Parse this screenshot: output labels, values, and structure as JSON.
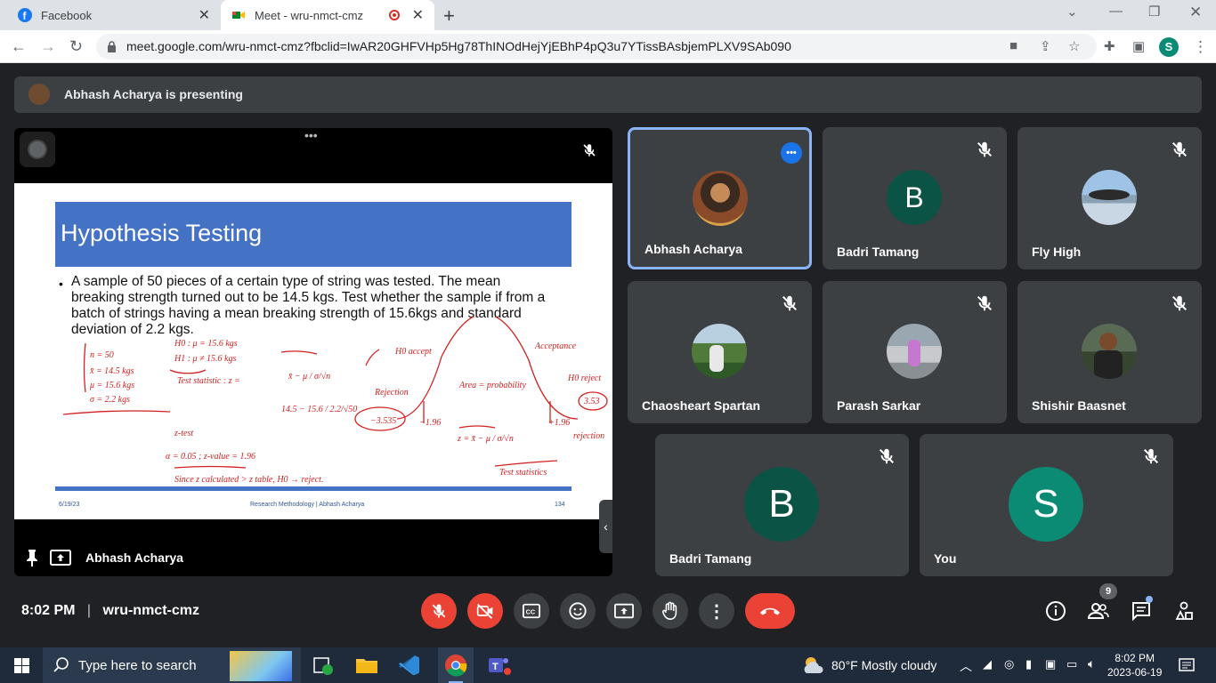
{
  "browser": {
    "tabs": [
      {
        "label": "Facebook"
      },
      {
        "label": "Meet - wru-nmct-cmz"
      }
    ],
    "url": "meet.google.com/wru-nmct-cmz?fbclid=IwAR20GHFVHp5Hg78ThINOdHejYjEBhP4pQ3u7YTissBAsbjemPLXV9SAb090",
    "profile_initial": "S"
  },
  "meet": {
    "presenting_text": "Abhash Acharya is presenting",
    "main_tile_name": "Abhash Acharya",
    "slide": {
      "title": "Hypothesis Testing",
      "body": "A sample of 50 pieces of a certain type of string was tested. The mean breaking strength turned out to be 14.5 kgs. Test whether the sample if from a batch of strings having a mean breaking strength of 15.6kgs and standard deviation of 2.2 kgs.",
      "footer_date": "6/19/23",
      "footer_center": "Research Methodology | Abhash Acharya",
      "footer_page": "134"
    },
    "participants": [
      {
        "name": "Abhash Acharya"
      },
      {
        "name": "Badri Tamang",
        "initial": "B"
      },
      {
        "name": "Fly High"
      },
      {
        "name": "Chaosheart Spartan"
      },
      {
        "name": "Parash Sarkar"
      },
      {
        "name": "Shishir Baasnet"
      },
      {
        "name": "Badri Tamang",
        "initial": "B"
      },
      {
        "name": "You",
        "initial": "S"
      }
    ],
    "time": "8:02 PM",
    "separator": "|",
    "meeting_code": "wru-nmct-cmz",
    "participant_count": "9"
  },
  "taskbar": {
    "search_placeholder": "Type here to search",
    "weather": "80°F  Mostly cloudy",
    "clock_time": "8:02 PM",
    "clock_date": "2023-06-19"
  },
  "colors": {
    "accent": "#1a73e8",
    "danger": "#ea4335",
    "tile_bg": "#3c4043",
    "letter_bg": "#0b5345",
    "you_bg": "#0b8a74"
  }
}
